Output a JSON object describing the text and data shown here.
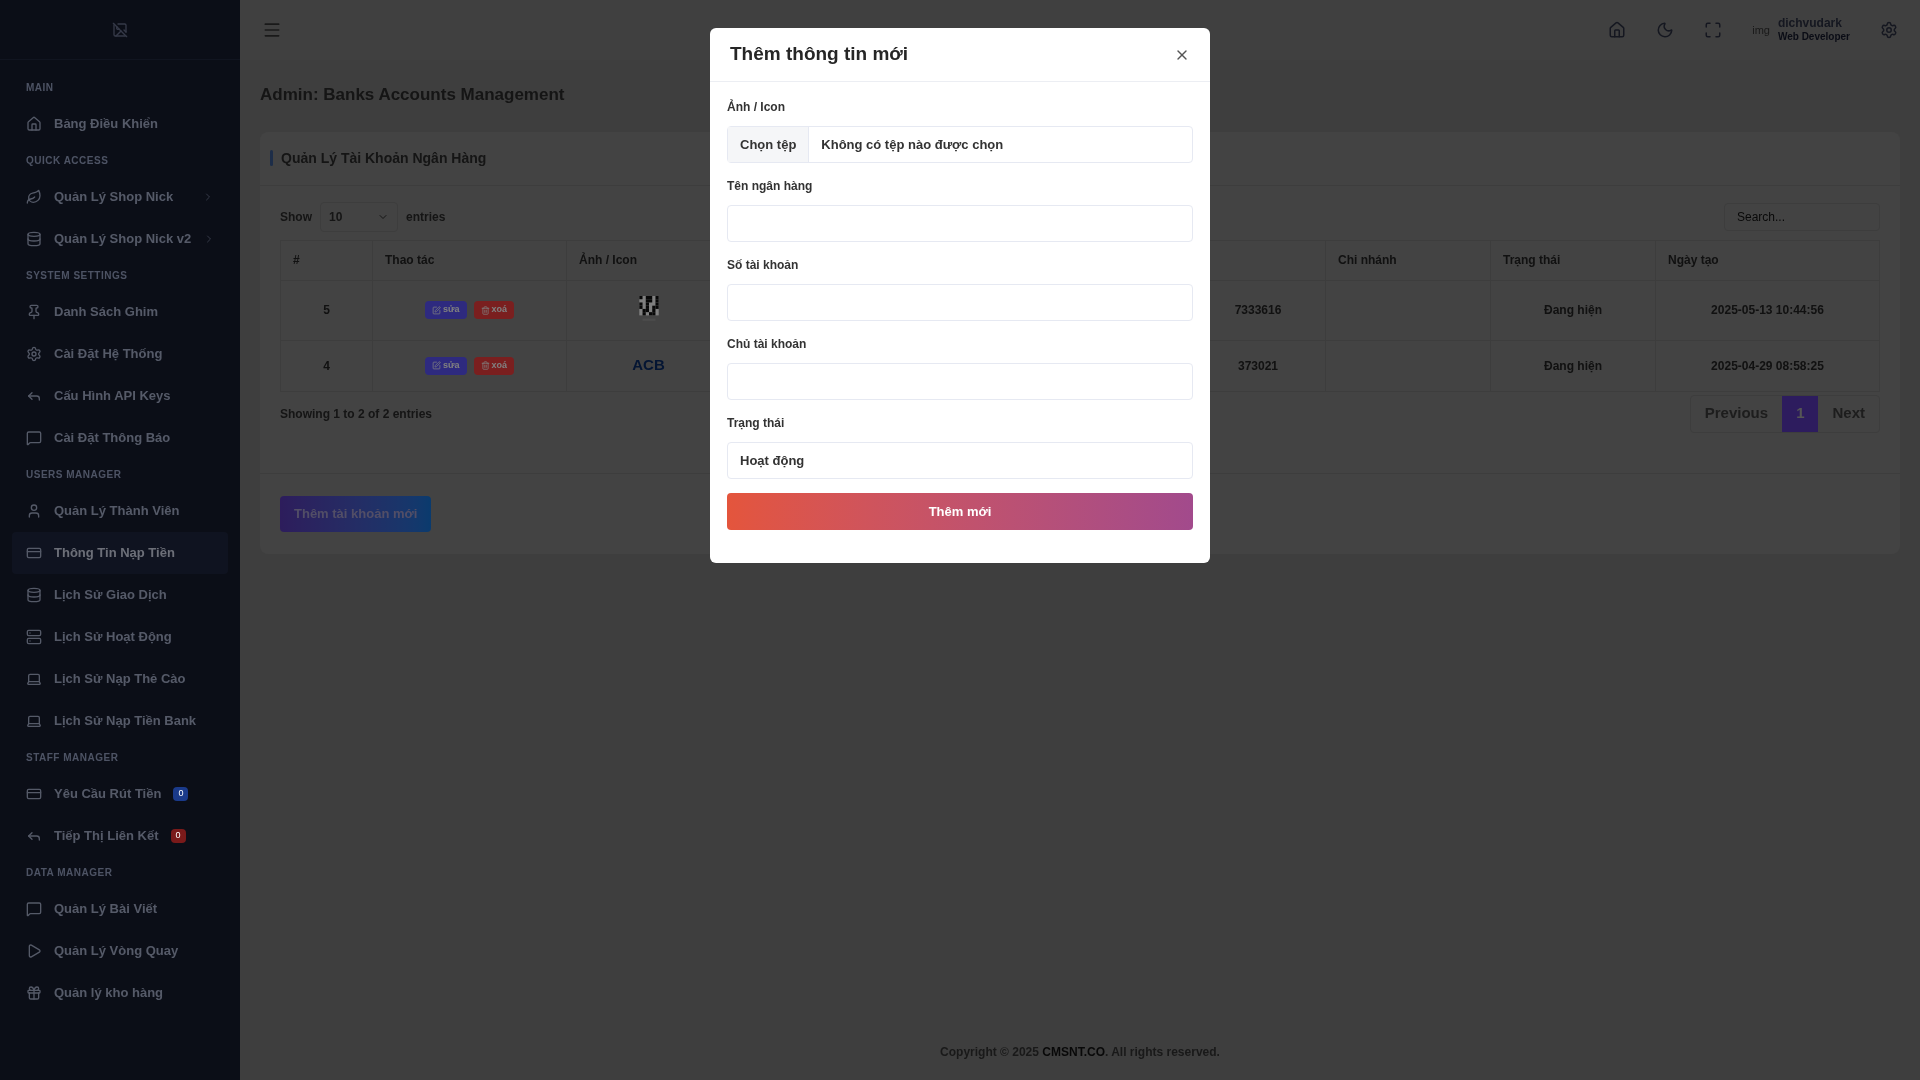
{
  "topbar": {
    "avatar_alt": "img",
    "user_name": "dichvudark",
    "user_role": "Web Developer"
  },
  "sidebar": {
    "sections": [
      {
        "title": "MAIN",
        "items": [
          {
            "label": "Bảng Điều Khiển",
            "selected": false
          }
        ]
      },
      {
        "title": "QUICK ACCESS",
        "items": [
          {
            "label": "Quản Lý Shop Nick",
            "selected": false,
            "expandable": true
          },
          {
            "label": "Quản Lý Shop Nick v2",
            "selected": false,
            "expandable": true
          }
        ]
      },
      {
        "title": "SYSTEM SETTINGS",
        "items": [
          {
            "label": "Danh Sách Ghim",
            "selected": false
          },
          {
            "label": "Cài Đặt Hệ Thống",
            "selected": false
          },
          {
            "label": "Cấu Hình API Keys",
            "selected": false
          },
          {
            "label": "Cài Đặt Thông Báo",
            "selected": false
          }
        ]
      },
      {
        "title": "USERS MANAGER",
        "items": [
          {
            "label": "Quản Lý Thành Viên",
            "selected": false
          },
          {
            "label": "Thông Tin Nạp Tiền",
            "selected": true
          },
          {
            "label": "Lịch Sử Giao Dịch",
            "selected": false
          },
          {
            "label": "Lịch Sử Hoạt Động",
            "selected": false
          },
          {
            "label": "Lịch Sử Nạp Thẻ Cào",
            "selected": false
          },
          {
            "label": "Lịch Sử Nạp Tiền Bank",
            "selected": false
          }
        ]
      },
      {
        "title": "STAFF MANAGER",
        "items": [
          {
            "label": "Yêu Cầu Rút Tiền",
            "selected": false,
            "badge": {
              "text": "0",
              "color": "#1a3a8a"
            }
          },
          {
            "label": "Tiếp Thị Liên Kết",
            "selected": false,
            "badge": {
              "text": "0",
              "color": "#7a1a1a"
            }
          }
        ]
      },
      {
        "title": "DATA MANAGER",
        "items": [
          {
            "label": "Quản Lý Bài Viết",
            "selected": false
          },
          {
            "label": "Quản Lý Vòng Quay",
            "selected": false
          },
          {
            "label": "Quản lý kho hàng",
            "selected": false
          }
        ]
      }
    ]
  },
  "page_title": "Admin: Banks Accounts Management",
  "card": {
    "title": "Quản Lý Tài Khoản Ngân Hàng",
    "length": {
      "before": "Show",
      "value": "10",
      "after": "entries"
    },
    "search": {
      "placeholder": "Search..."
    },
    "columns": [
      {
        "label": "#"
      },
      {
        "label": "Thao tác"
      },
      {
        "label": "Ảnh / Icon"
      },
      {},
      {},
      {
        "label": "Chi nhánh"
      },
      {
        "label": "Trạng thái"
      },
      {
        "label": "Ngày tạo"
      }
    ],
    "rows": [
      {
        "number": "5",
        "edit": "sửa",
        "delete": "xoá",
        "image": {
          "kind": "qr"
        },
        "account": "7333616",
        "status": "Đang hiện",
        "created": "2025-05-13 10:44:56"
      },
      {
        "number": "4",
        "edit": "sửa",
        "delete": "xoá",
        "image": {
          "kind": "logo",
          "text": "ACB"
        },
        "account": "373021",
        "status": "Đang hiện",
        "created": "2025-04-29 08:58:25"
      }
    ],
    "info": "Showing 1 to 2 of 2 entries",
    "pagination": [
      {
        "label": "Previous",
        "selected": false
      },
      {
        "label": "1",
        "selected": true
      },
      {
        "label": "Next",
        "selected": false
      }
    ],
    "add_button": "Thêm tài khoản mới"
  },
  "footer": {
    "before": "Copyright © 2025 ",
    "brand": "CMSNT.CO",
    "after": ". All rights reserved."
  },
  "modal": {
    "title": "Thêm thông tin mới",
    "fields": [
      {
        "kind": "file",
        "label": "Ảnh / Icon",
        "button": "Chọn tệp",
        "value": "Không có tệp nào được chọn"
      },
      {
        "kind": "text",
        "label": "Tên ngân hàng"
      },
      {
        "kind": "text",
        "label": "Số tài khoản"
      },
      {
        "kind": "text",
        "label": "Chủ tài khoản"
      },
      {
        "kind": "select",
        "label": "Trạng thái",
        "value": "Hoạt động"
      }
    ],
    "submit": "Thêm mới"
  }
}
